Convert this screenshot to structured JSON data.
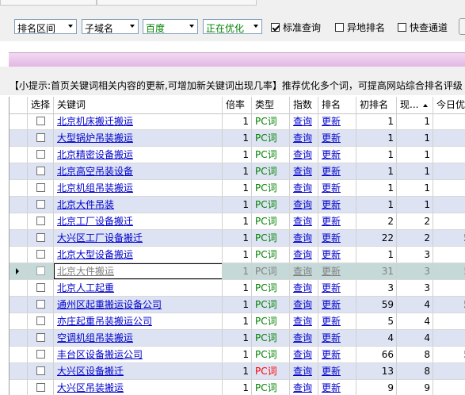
{
  "toolbar": {
    "combo_rank_range": "排名区间",
    "combo_subdomain": "子域名",
    "combo_engine": "百度",
    "combo_status": "正在优化",
    "chk_standard_query": "标准查询",
    "chk_standard_checked": true,
    "chk_remote_rank": "异地排名",
    "chk_remote_checked": false,
    "chk_fast_channel": "快查通道",
    "chk_fast_checked": false
  },
  "hint": "【小提示:首页关键词相关内容的更新,可增加新关键词出现几率】推荐优化多个词，可提高网站综合排名评级",
  "table": {
    "headers": {
      "select": "选择",
      "keyword": "关键词",
      "multiple": "倍率",
      "type": "类型",
      "index": "指数",
      "rank": "排名",
      "initial_rank": "初排名",
      "current": "现...",
      "today": "今日优"
    },
    "rows": [
      {
        "keyword": "北京机床搬迁搬运",
        "multiple": "1",
        "type": "PC词",
        "index": "查询",
        "rank": "更新",
        "initial": "1",
        "current": "1",
        "today": ""
      },
      {
        "keyword": "大型锅炉吊装搬运",
        "multiple": "1",
        "type": "PC词",
        "index": "查询",
        "rank": "更新",
        "initial": "1",
        "current": "1",
        "today": ""
      },
      {
        "keyword": "北京精密设备搬运",
        "multiple": "1",
        "type": "PC词",
        "index": "查询",
        "rank": "更新",
        "initial": "1",
        "current": "1",
        "today": ""
      },
      {
        "keyword": "北京高空吊装设备",
        "multiple": "1",
        "type": "PC词",
        "index": "查询",
        "rank": "更新",
        "initial": "1",
        "current": "1",
        "today": ""
      },
      {
        "keyword": "北京机组吊装搬运",
        "multiple": "1",
        "type": "PC词",
        "index": "查询",
        "rank": "更新",
        "initial": "1",
        "current": "1",
        "today": ""
      },
      {
        "keyword": "北京大件吊装",
        "multiple": "1",
        "type": "PC词",
        "index": "查询",
        "rank": "更新",
        "initial": "1",
        "current": "1",
        "today": ""
      },
      {
        "keyword": "北京工厂设备搬迁",
        "multiple": "1",
        "type": "PC词",
        "index": "查询",
        "rank": "更新",
        "initial": "2",
        "current": "2",
        "today": ""
      },
      {
        "keyword": "大兴区工厂设备搬迁",
        "multiple": "1",
        "type": "PC词",
        "index": "查询",
        "rank": "更新",
        "initial": "22",
        "current": "2",
        "today": "5"
      },
      {
        "keyword": "北京大型设备搬运",
        "multiple": "1",
        "type": "PC词",
        "index": "查询",
        "rank": "更新",
        "initial": "1",
        "current": "3",
        "today": ""
      },
      {
        "keyword": "北京大件搬运",
        "multiple": "1",
        "type": "PC词",
        "index": "查询",
        "rank": "更新",
        "initial": "31",
        "current": "3",
        "today": "5"
      },
      {
        "keyword": "北京人工起重",
        "multiple": "1",
        "type": "PC词",
        "index": "查询",
        "rank": "更新",
        "initial": "3",
        "current": "3",
        "today": ""
      },
      {
        "keyword": "通州区起重搬运设备公司",
        "multiple": "1",
        "type": "PC词",
        "index": "查询",
        "rank": "更新",
        "initial": "59",
        "current": "4",
        "today": "5"
      },
      {
        "keyword": "亦庄起重吊装搬运公司",
        "multiple": "1",
        "type": "PC词",
        "index": "查询",
        "rank": "更新",
        "initial": "5",
        "current": "4",
        "today": ""
      },
      {
        "keyword": "空调机组吊装搬运",
        "multiple": "1",
        "type": "PC词",
        "index": "查询",
        "rank": "更新",
        "initial": "4",
        "current": "4",
        "today": ""
      },
      {
        "keyword": "丰台区设备搬运公司",
        "multiple": "1",
        "type": "PC词",
        "index": "查询",
        "rank": "更新",
        "initial": "66",
        "current": "8",
        "today": "5"
      },
      {
        "keyword": "大兴区设备搬迁",
        "multiple": "1",
        "type": "PC词",
        "index": "查询",
        "rank": "更新",
        "initial": "13",
        "current": "8",
        "today": ""
      },
      {
        "keyword": "大兴区吊装搬运",
        "multiple": "1",
        "type": "PC词",
        "index": "查询",
        "rank": "更新",
        "initial": "9",
        "current": "9",
        "today": ""
      }
    ]
  },
  "colors": {
    "row_alt": "#dde3f3",
    "row_selected": "#c5d9d9",
    "link_blue": "#0000cc",
    "pc_green": "#008000",
    "pc_red": "#ff0000",
    "hint_bar": "#e8c4e8"
  }
}
